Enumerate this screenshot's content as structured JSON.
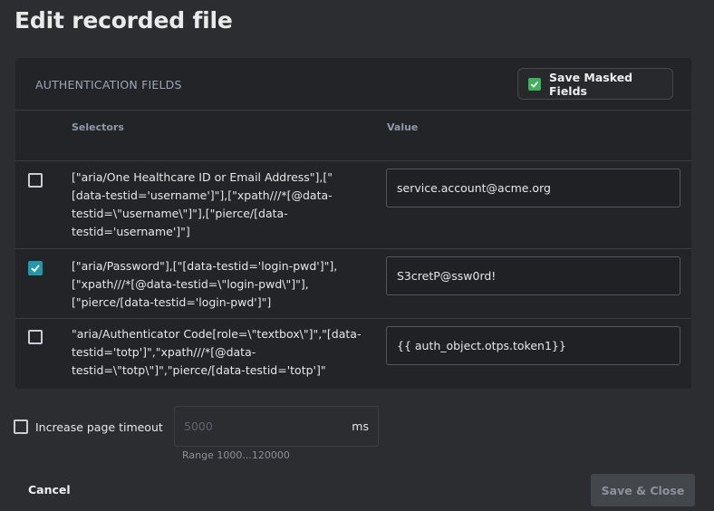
{
  "dialog": {
    "title": "Edit recorded file",
    "section_label": "AUTHENTICATION FIELDS",
    "save_masked": {
      "label": "Save Masked Fields",
      "checked": true
    },
    "columns": {
      "selectors": "Selectors",
      "value": "Value"
    },
    "rows": [
      {
        "checked": false,
        "selector": "[\"aria/One Healthcare ID or Email Address\"],[\"[data-testid='username']\"],[\"xpath///*[@data-testid=\\\"username\\\"]\"],[\"pierce/[data-testid='username']\"]",
        "value": "service.account@acme.org"
      },
      {
        "checked": true,
        "selector": "[\"aria/Password\"],[\"[data-testid='login-pwd']\"],[\"xpath///*[@data-testid=\\\"login-pwd\\\"]\"],[\"pierce/[data-testid='login-pwd']\"]",
        "value": "S3cretP@ssw0rd!"
      },
      {
        "checked": false,
        "selector": "\"aria/Authenticator Code[role=\\\"textbox\\\"]\",\"[data-testid='totp']\",\"xpath///*[@data-testid=\\\"totp\\\"]\",\"pierce/[data-testid='totp']\"",
        "value": "{{ auth_object.otps.token1}}"
      }
    ],
    "timeout": {
      "label": "Increase page timeout",
      "checked": false,
      "placeholder": "5000",
      "unit": "ms",
      "range": "Range 1000...120000"
    },
    "buttons": {
      "cancel": "Cancel",
      "save_close": "Save & Close"
    },
    "colors": {
      "accent_teal": "#1e9aab",
      "accent_green": "#3bb35a",
      "background": "#2b2d30"
    }
  }
}
